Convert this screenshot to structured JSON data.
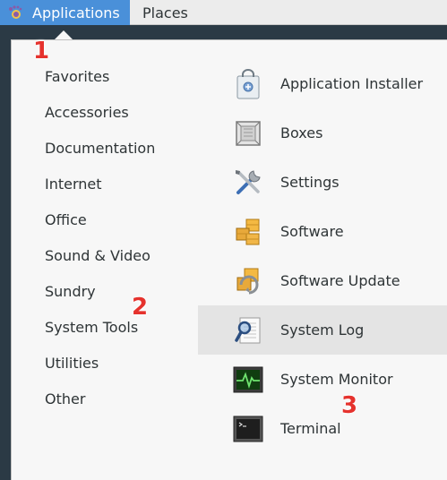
{
  "panel": {
    "applications_label": "Applications",
    "places_label": "Places"
  },
  "categories": [
    "Favorites",
    "Accessories",
    "Documentation",
    "Internet",
    "Office",
    "Sound & Video",
    "Sundry",
    "System Tools",
    "Utilities",
    "Other"
  ],
  "apps": [
    {
      "label": "Application Installer",
      "icon": "installer-bag-icon"
    },
    {
      "label": "Boxes",
      "icon": "boxes-icon"
    },
    {
      "label": "Settings",
      "icon": "settings-tools-icon"
    },
    {
      "label": "Software",
      "icon": "software-packages-icon"
    },
    {
      "label": "Software Update",
      "icon": "software-update-icon"
    },
    {
      "label": "System Log",
      "icon": "system-log-icon",
      "highlighted": true
    },
    {
      "label": "System Monitor",
      "icon": "system-monitor-icon"
    },
    {
      "label": "Terminal",
      "icon": "terminal-icon"
    }
  ],
  "annotations": [
    "1",
    "2",
    "3"
  ],
  "colors": {
    "accent": "#4a90d9",
    "marker": "#e5322d",
    "popup_bg": "#f7f7f7",
    "highlight": "#e4e4e4"
  }
}
